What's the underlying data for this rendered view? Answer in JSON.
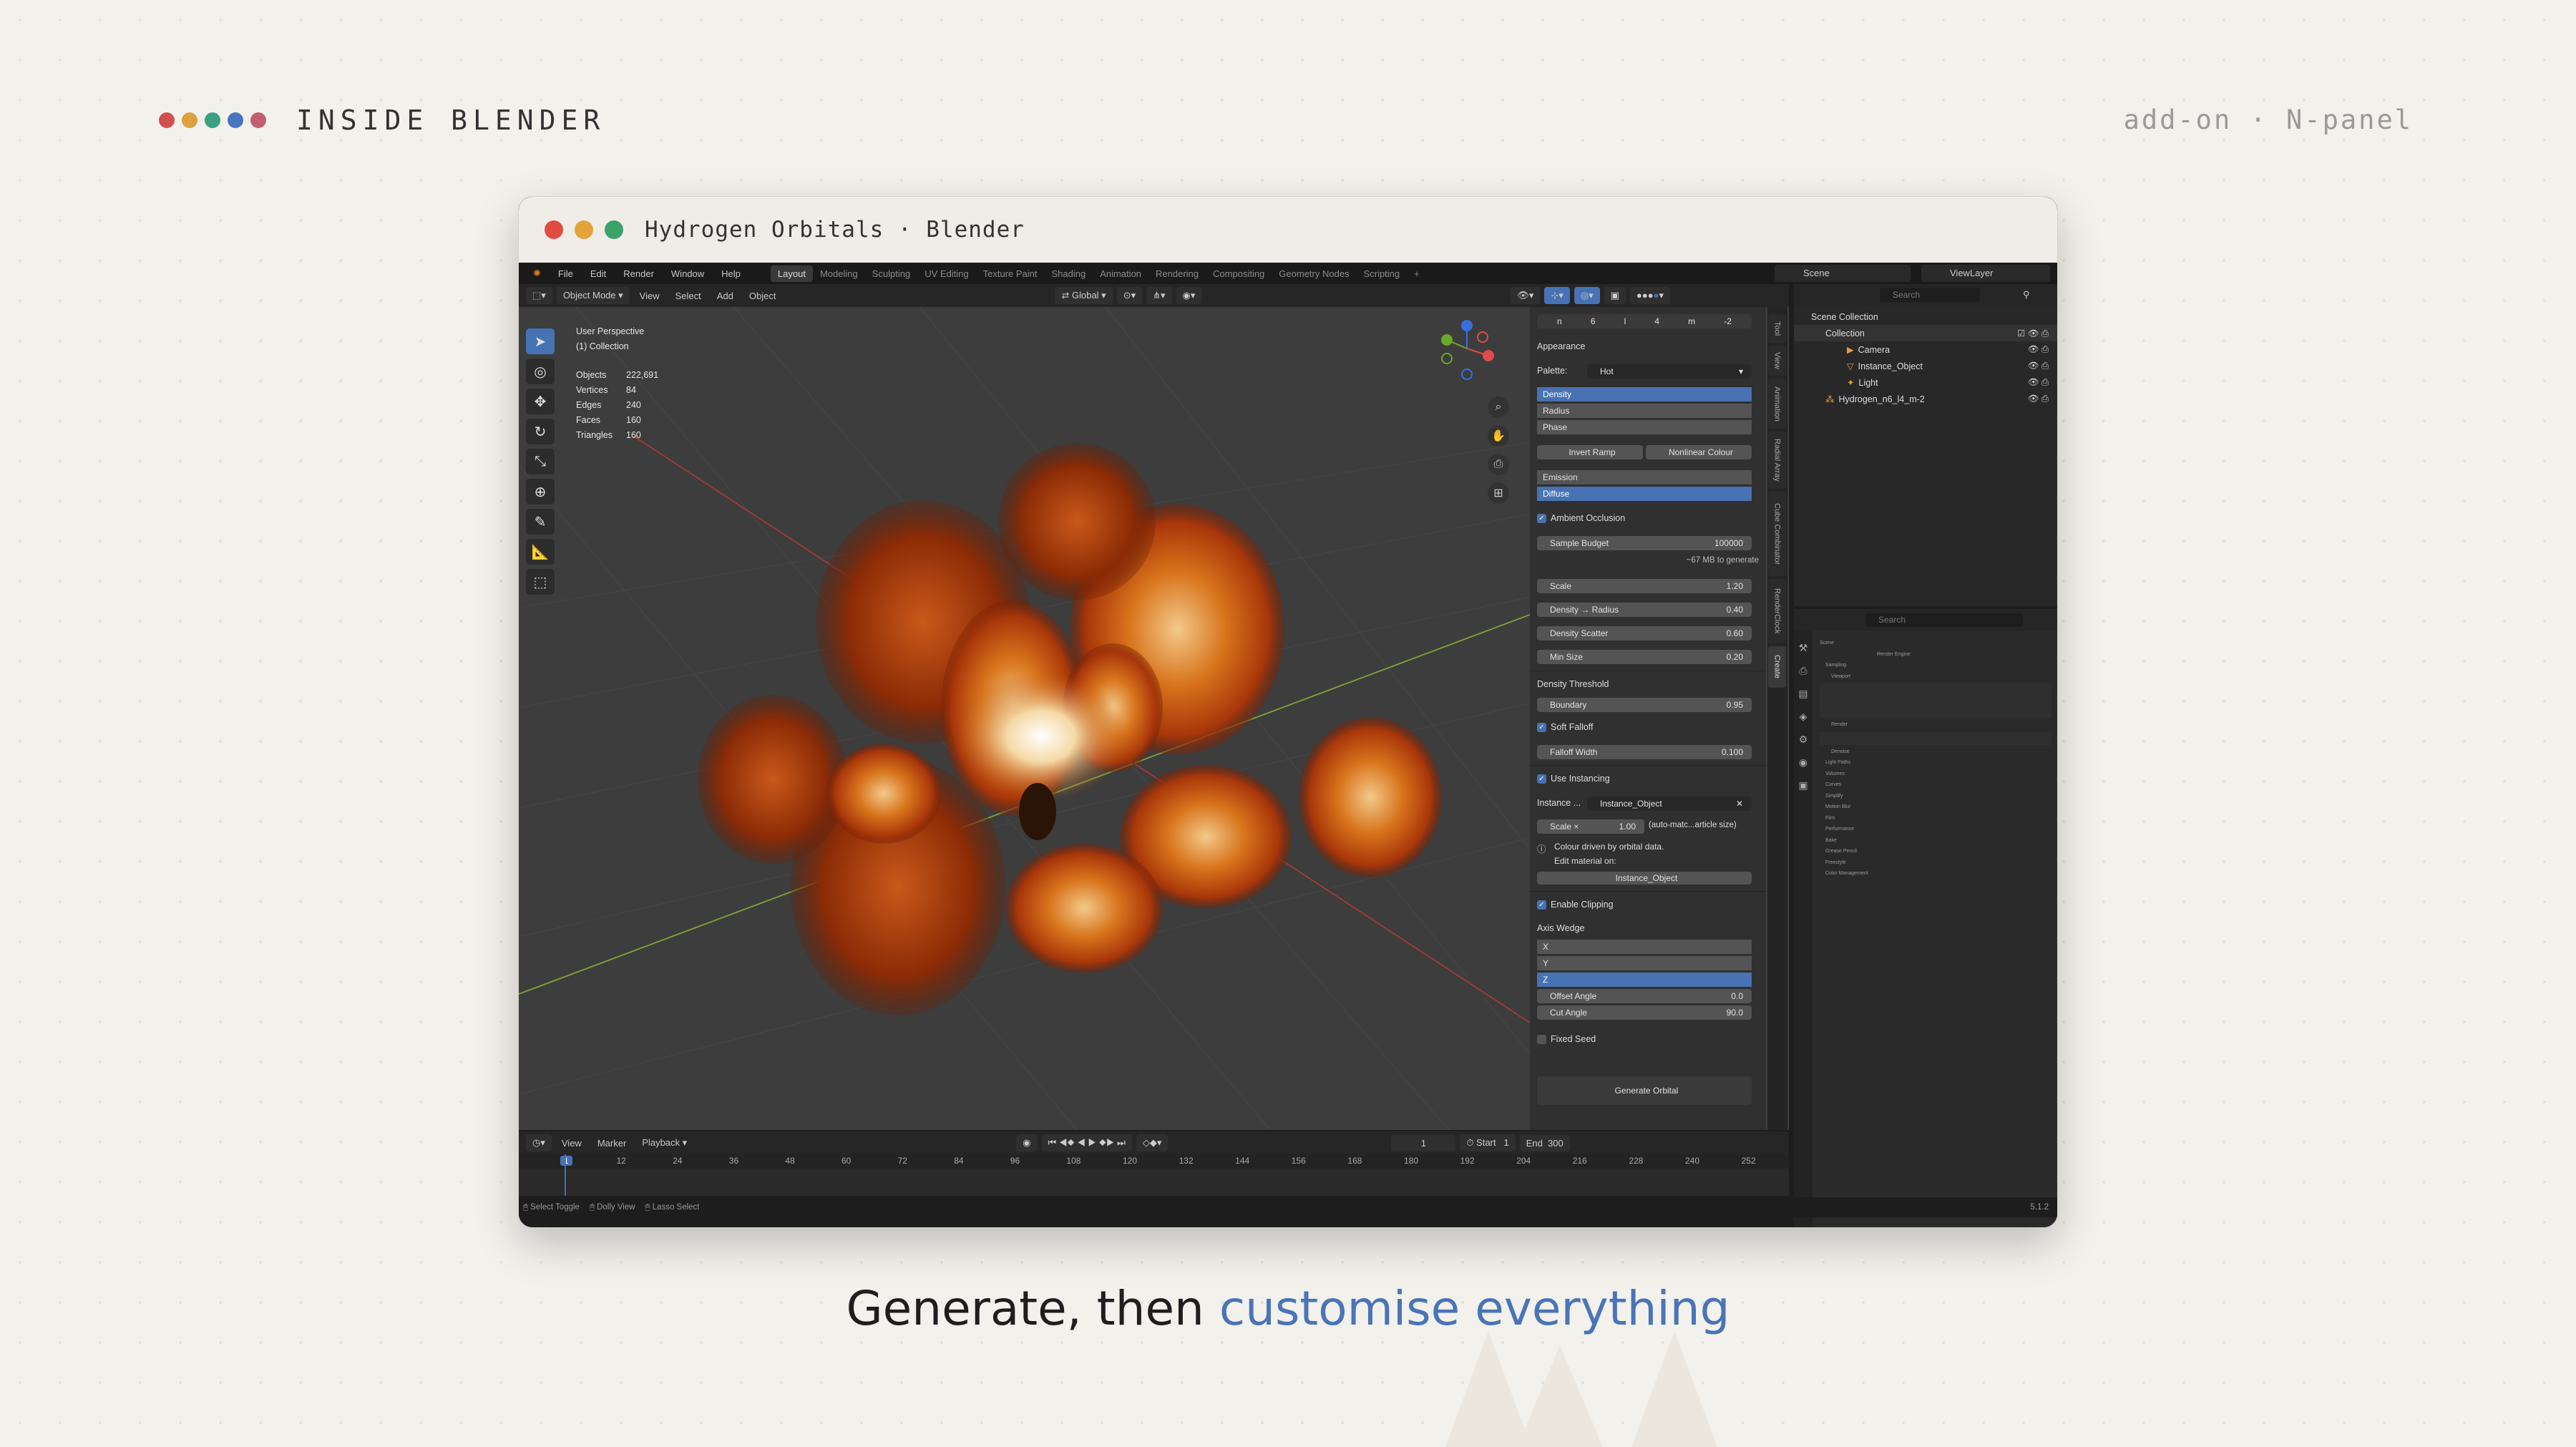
{
  "header": {
    "title": "INSIDE BLENDER",
    "right_label": "add-on · N-panel",
    "dot_colors": [
      "#d05050",
      "#e0a040",
      "#3aa080",
      "#4a74c0",
      "#c06070"
    ]
  },
  "window": {
    "title": "Hydrogen Orbitals · Blender",
    "traffic_lights": [
      "#e04b43",
      "#e6a33a",
      "#3aa26a"
    ]
  },
  "menubar": {
    "items": [
      "File",
      "Edit",
      "Render",
      "Window",
      "Help"
    ],
    "workspaces": [
      "Layout",
      "Modeling",
      "Sculpting",
      "UV Editing",
      "Texture Paint",
      "Shading",
      "Animation",
      "Rendering",
      "Compositing",
      "Geometry Nodes",
      "Scripting",
      "+"
    ],
    "active_workspace": "Layout",
    "scene": "Scene",
    "view_layer": "ViewLayer"
  },
  "viewport_header": {
    "mode": "Object Mode",
    "menus": [
      "View",
      "Select",
      "Add",
      "Object"
    ],
    "orientation": "Global",
    "options": "Options"
  },
  "viewport": {
    "perspective": "User Perspective",
    "collection": "(1) Collection",
    "stats": [
      {
        "k": "Objects",
        "v": "222,691"
      },
      {
        "k": "Vertices",
        "v": "84"
      },
      {
        "k": "Edges",
        "v": "240"
      },
      {
        "k": "Faces",
        "v": "160"
      },
      {
        "k": "Triangles",
        "v": "160"
      }
    ],
    "accent": "#c44a10"
  },
  "npanel": {
    "quantum_row": [
      "n",
      "6",
      "l",
      "4",
      "m",
      "-2"
    ],
    "appearance": "Appearance",
    "palette_label": "Palette:",
    "palette_value": "Hot",
    "color_modes": [
      "Density",
      "Radius",
      "Phase"
    ],
    "color_mode_selected": "Density",
    "invert_ramp": "Invert Ramp",
    "nonlinear": "Nonlinear Colour",
    "shading": [
      "Emission",
      "Diffuse"
    ],
    "shading_selected": "Diffuse",
    "ambient_occlusion": "Ambient Occlusion",
    "sample_budget_label": "Sample Budget",
    "sample_budget_value": "100000",
    "memory_note": "~67 MB to generate",
    "scale_label": "Scale",
    "scale_value": "1.20",
    "density_radius_label": "Density → Radius",
    "density_radius_value": "0.40",
    "density_scatter_label": "Density Scatter",
    "density_scatter_value": "0.60",
    "min_size_label": "Min Size",
    "min_size_value": "0.20",
    "density_threshold": "Density Threshold",
    "boundary_label": "Boundary",
    "boundary_value": "0.95",
    "soft_falloff": "Soft Falloff",
    "falloff_width_label": "Falloff Width",
    "falloff_width_value": "0.100",
    "use_instancing": "Use Instancing",
    "instance_label": "Instance ...",
    "instance_value": "Instance_Object",
    "scale_x_label": "Scale ×",
    "scale_x_value": "1.00",
    "auto_note": "(auto-matc...article size)",
    "colour_note": "Colour driven by orbital data.",
    "edit_note": "Edit material on:",
    "material_obj": "Instance_Object",
    "enable_clipping": "Enable Clipping",
    "axis_wedge": "Axis Wedge",
    "axes": [
      "X",
      "Y",
      "Z"
    ],
    "axis_selected": "Z",
    "offset_angle_label": "Offset Angle",
    "offset_angle_value": "0.0",
    "cut_angle_label": "Cut Angle",
    "cut_angle_value": "90.0",
    "fixed_seed": "Fixed Seed",
    "generate": "Generate Orbital"
  },
  "ntabs": [
    "Tool",
    "View",
    "Animation",
    "Radial Array",
    "Cube Combinator",
    "RenderClock",
    "Create"
  ],
  "outliner": {
    "search_placeholder": "Search",
    "scene_collection": "Scene Collection",
    "items": [
      "Collection",
      "Camera",
      "Instance_Object",
      "Light",
      "Hydrogen_n6_l4_m-2"
    ]
  },
  "properties": {
    "search_placeholder": "Search",
    "rows": [
      "Scene",
      "Render Engine",
      "Sampling",
      "Viewport",
      "Render",
      "Denoise",
      "Light Paths",
      "Volumes",
      "Curves",
      "Simplify",
      "Motion Blur",
      "Film",
      "Performance",
      "Bake",
      "Grease Pencil",
      "Freestyle",
      "Color Management"
    ]
  },
  "timeline": {
    "menus": [
      "View",
      "Marker",
      "Playback"
    ],
    "current_frame": "1",
    "start_label": "Start",
    "start_value": "1",
    "end_label": "End",
    "end_value": "300",
    "frames": [
      "1",
      "12",
      "24",
      "36",
      "48",
      "60",
      "72",
      "84",
      "96",
      "108",
      "120",
      "132",
      "144",
      "156",
      "168",
      "180",
      "192",
      "204",
      "216",
      "228",
      "240",
      "252"
    ]
  },
  "statusbar": {
    "items": [
      "Select Toggle",
      "Dolly View",
      "Lasso Select"
    ],
    "version": "5.1.2"
  },
  "caption": {
    "prefix": "Generate, then ",
    "highlight": "customise everything"
  }
}
